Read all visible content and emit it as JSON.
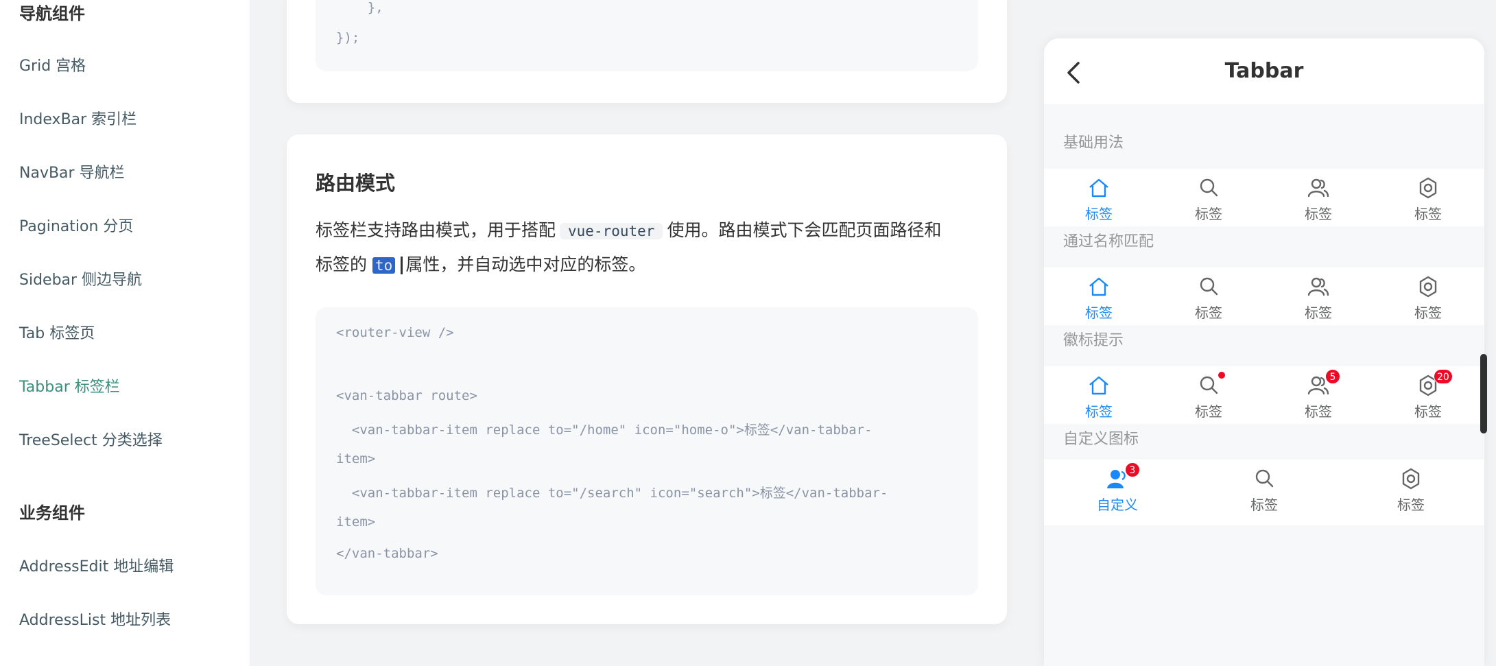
{
  "sidebar": {
    "group1": "导航组件",
    "items": [
      {
        "label": "Grid 宫格"
      },
      {
        "label": "IndexBar 索引栏"
      },
      {
        "label": "NavBar 导航栏"
      },
      {
        "label": "Pagination 分页"
      },
      {
        "label": "Sidebar 侧边导航"
      },
      {
        "label": "Tab 标签页"
      },
      {
        "label": "Tabbar 标签栏",
        "active": true
      },
      {
        "label": "TreeSelect 分类选择"
      }
    ],
    "group2": "业务组件",
    "items2": [
      {
        "label": "AddressEdit 地址编辑"
      },
      {
        "label": "AddressList 地址列表"
      }
    ]
  },
  "content": {
    "top_code": [
      "    },",
      "});"
    ],
    "section_title": "路由模式",
    "para_line1_a": "标签栏支持路由模式，用于搭配",
    "para_code1": "vue-router",
    "para_line1_b": "使用。路由模式下会匹配页面路径和",
    "para_line2_a": "标签的",
    "para_code2": "to",
    "para_line2_b": "属性，并自动选中对应的标签。",
    "code": [
      "<router-view />",
      "",
      "<van-tabbar route>",
      "  <van-tabbar-item replace to=\"/home\" icon=\"home-o\">标签</van-tabbar-",
      "item>",
      "  <van-tabbar-item replace to=\"/search\" icon=\"search\">标签</van-tabbar-",
      "item>",
      "</van-tabbar>"
    ]
  },
  "phone": {
    "title": "Tabbar",
    "demos": [
      {
        "title": "基础用法",
        "tabs": [
          "标签",
          "标签",
          "标签",
          "标签"
        ]
      },
      {
        "title": "通过名称匹配",
        "tabs": [
          "标签",
          "标签",
          "标签",
          "标签"
        ]
      },
      {
        "title": "徽标提示",
        "tabs": [
          "标签",
          "标签",
          "标签",
          "标签"
        ],
        "badges": [
          "",
          "dot",
          "5",
          "20"
        ]
      },
      {
        "title": "自定义图标",
        "tabs": [
          "自定义",
          "标签",
          "标签"
        ],
        "badges": [
          "3",
          "",
          ""
        ]
      }
    ],
    "icons": [
      "home-o",
      "search",
      "friends-o",
      "setting-o"
    ],
    "active_color": "#1989fa",
    "badge_color": "#ee0a24"
  }
}
